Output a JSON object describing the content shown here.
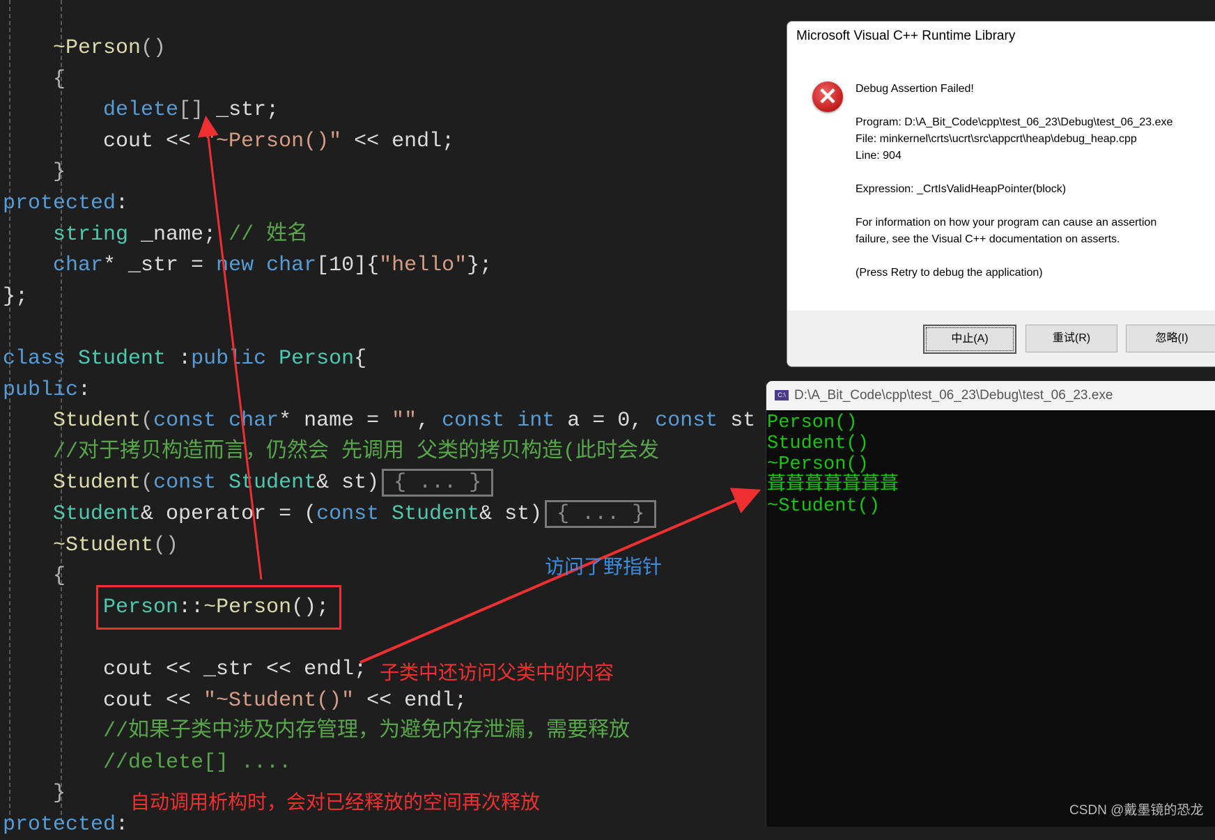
{
  "code": {
    "lines": [
      [
        [
          "    ~Person",
          "f"
        ],
        [
          "()",
          "p"
        ]
      ],
      [
        [
          "    {",
          "p"
        ]
      ],
      [
        [
          "        ",
          "t"
        ],
        [
          "delete",
          "k"
        ],
        [
          "[]",
          "p"
        ],
        [
          " _str;",
          "t"
        ]
      ],
      [
        [
          "        cout << ",
          "t"
        ],
        [
          "\"~Person()\"",
          "s"
        ],
        [
          " << endl;",
          "t"
        ]
      ],
      [
        [
          "    }",
          "p"
        ]
      ],
      [
        [
          "protected",
          "k"
        ],
        [
          ":",
          "t"
        ]
      ],
      [
        [
          "    ",
          "t"
        ],
        [
          "string",
          "y"
        ],
        [
          " _name; ",
          "t"
        ],
        [
          "// 姓名",
          "c"
        ]
      ],
      [
        [
          "    ",
          "t"
        ],
        [
          "char",
          "k"
        ],
        [
          "* _str = ",
          "t"
        ],
        [
          "new",
          "k"
        ],
        [
          " ",
          "t"
        ],
        [
          "char",
          "k"
        ],
        [
          "[10]{",
          "t"
        ],
        [
          "\"hello\"",
          "s"
        ],
        [
          "};",
          "t"
        ]
      ],
      [
        [
          "};",
          "t"
        ]
      ],
      [],
      [
        [
          "class",
          "k"
        ],
        [
          " ",
          "t"
        ],
        [
          "Student",
          "y"
        ],
        [
          " :",
          "t"
        ],
        [
          "public",
          "k"
        ],
        [
          " ",
          "t"
        ],
        [
          "Person",
          "y"
        ],
        [
          "{",
          "t"
        ]
      ],
      [
        [
          "public",
          "k"
        ],
        [
          ":",
          "t"
        ]
      ],
      [
        [
          "    Student",
          "f"
        ],
        [
          "(",
          "p"
        ],
        [
          "const",
          "k"
        ],
        [
          " ",
          "t"
        ],
        [
          "char",
          "k"
        ],
        [
          "* name = ",
          "t"
        ],
        [
          "\"\"",
          "s"
        ],
        [
          ", ",
          "t"
        ],
        [
          "const",
          "k"
        ],
        [
          " ",
          "t"
        ],
        [
          "int",
          "k"
        ],
        [
          " a = 0, ",
          "t"
        ],
        [
          "const",
          "k"
        ],
        [
          " st",
          "t"
        ]
      ],
      [
        [
          "    //对于拷贝构造而言，仍然会 先调用 父类的拷贝构造(此时会发",
          "c"
        ]
      ],
      [
        [
          "    Student",
          "f"
        ],
        [
          "(",
          "p"
        ],
        [
          "const",
          "k"
        ],
        [
          " ",
          "t"
        ],
        [
          "Student",
          "y"
        ],
        [
          "& st)",
          "t"
        ],
        [
          "{ ... }",
          "fold"
        ]
      ],
      [
        [
          "    ",
          "t"
        ],
        [
          "Student",
          "y"
        ],
        [
          "& operator = (",
          "t"
        ],
        [
          "const",
          "k"
        ],
        [
          " ",
          "t"
        ],
        [
          "Student",
          "y"
        ],
        [
          "& st)",
          "t"
        ],
        [
          "{ ... }",
          "fold"
        ]
      ],
      [
        [
          "    ~Student",
          "f"
        ],
        [
          "()",
          "p"
        ]
      ],
      [
        [
          "    {",
          "p"
        ]
      ],
      [
        [
          "        ",
          "t"
        ],
        [
          "Person",
          "y"
        ],
        [
          "::",
          "t"
        ],
        [
          "~Person",
          "f"
        ],
        [
          "();",
          "t"
        ]
      ],
      [],
      [
        [
          "        cout << _str << endl;",
          "t"
        ]
      ],
      [
        [
          "        cout << ",
          "t"
        ],
        [
          "\"~Student()\"",
          "s"
        ],
        [
          " << endl;",
          "t"
        ]
      ],
      [
        [
          "        //如果子类中涉及内存管理，为避免内存泄漏，需要释放",
          "c"
        ]
      ],
      [
        [
          "        //delete[] ....",
          "c"
        ]
      ],
      [
        [
          "    }",
          "p"
        ]
      ],
      [
        [
          "protected",
          "k"
        ],
        [
          ":",
          "t"
        ]
      ]
    ]
  },
  "dialog": {
    "title": "Microsoft Visual C++ Runtime Library",
    "icon": "error-icon",
    "heading": "Debug Assertion Failed!",
    "program": "Program: D:\\A_Bit_Code\\cpp\\test_06_23\\Debug\\test_06_23.exe",
    "file": "File: minkernel\\crts\\ucrt\\src\\appcrt\\heap\\debug_heap.cpp",
    "line": "Line: 904",
    "expression": "Expression: _CrtIsValidHeapPointer(block)",
    "info1": "For information on how your program can cause an assertion",
    "info2": "failure, see the Visual C++ documentation on asserts.",
    "retry_hint": "(Press Retry to debug the application)",
    "buttons": {
      "abort": "中止(A)",
      "retry": "重试(R)",
      "ignore": "忽略(I)"
    }
  },
  "console": {
    "title": "D:\\A_Bit_Code\\cpp\\test_06_23\\Debug\\test_06_23.exe",
    "output": [
      "Person()",
      "Student()",
      "~Person()",
      "葺葺葺葺葺葺葺",
      "~Student()"
    ]
  },
  "annotations": {
    "wild_pointer": "访问了野指针",
    "child_access": "子类中还访问父类中的内容",
    "double_free": "自动调用析构时，会对已经释放的空间再次释放",
    "color_red": "#f03030",
    "color_blue": "#3b8ee0"
  },
  "watermark": "CSDN @戴墨镜的恐龙"
}
